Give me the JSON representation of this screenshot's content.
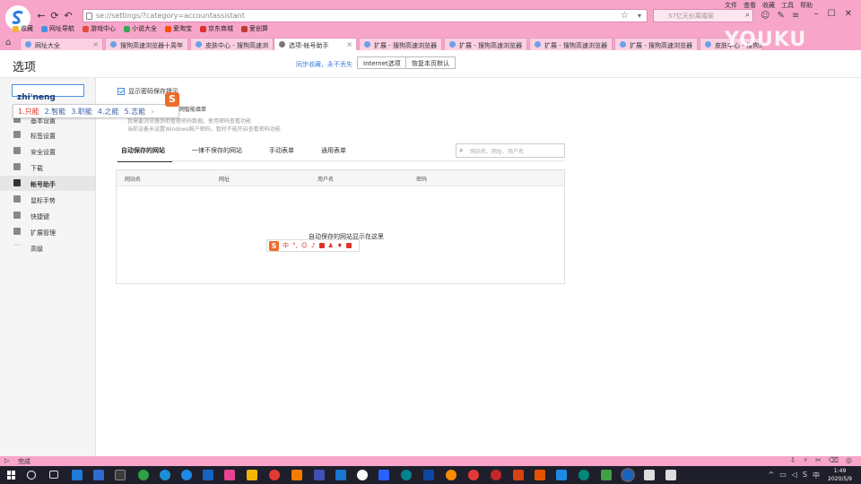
{
  "browser": {
    "url": "se://settings/?category=accountassistant",
    "search_placeholder": "57亿天价离婚案",
    "menu": [
      "文件",
      "查看",
      "收藏",
      "工具",
      "帮助"
    ],
    "bookmarks": [
      "收藏",
      "网址导航",
      "游戏中心",
      "小说大全",
      "爱淘宝",
      "京东商城",
      "爱创算"
    ],
    "tabs": [
      {
        "label": "网址大全",
        "active": false
      },
      {
        "label": "搜狗高速浏览器十周年",
        "active": false
      },
      {
        "label": "皮肤中心 - 搜狗高速浏",
        "active": false
      },
      {
        "label": "选项-帐号助手",
        "active": true
      },
      {
        "label": "扩展 - 搜狗高速浏览器",
        "active": false
      },
      {
        "label": "扩展 - 搜狗高速浏览器",
        "active": false
      },
      {
        "label": "扩展 - 搜狗高速浏览器",
        "active": false
      },
      {
        "label": "扩展 - 搜狗高速浏览器",
        "active": false
      },
      {
        "label": "皮肤中心 - 搜狗高速",
        "active": false
      }
    ],
    "watermark": "YOUKU"
  },
  "page": {
    "title": "选项",
    "sync_text": "同步收藏，永不丢失",
    "internet_options": "Internet选项",
    "restore_default": "恢复本页默认"
  },
  "sidebar": {
    "search_value": "",
    "items": [
      {
        "label": "基本设置",
        "active": false
      },
      {
        "label": "标签设置",
        "active": false
      },
      {
        "label": "安全设置",
        "active": false
      },
      {
        "label": "下载",
        "active": false
      },
      {
        "label": "帐号助手",
        "active": true
      },
      {
        "label": "鼠标手势",
        "active": false
      },
      {
        "label": "快捷键",
        "active": false
      },
      {
        "label": "扩展管理",
        "active": false
      },
      {
        "label": "高级",
        "active": false
      }
    ]
  },
  "main": {
    "show_password_prompt": "显示密码保存提示",
    "smart_fill": "网智能填单",
    "hint1": "我需要浏览器协助管理密码数据。使用密码查看功能",
    "hint2": "当前设备未设置Windows帐户密码，暂时不能开启查看密码功能",
    "subtabs": [
      {
        "label": "自动保存的网站",
        "active": true
      },
      {
        "label": "一律不保存的网站",
        "active": false
      },
      {
        "label": "手动表单",
        "active": false
      },
      {
        "label": "通用表单",
        "active": false
      }
    ],
    "site_search_placeholder": "网站名、网址、用户名",
    "columns": [
      "网站名",
      "网址",
      "用户名",
      "密码"
    ],
    "empty_text": "自动保存的网站显示在这里"
  },
  "ime": {
    "pinyin": "zhi'neng",
    "candidates": [
      "1.只能",
      "2.智能",
      "3.职能",
      "4.之能",
      "5.志能"
    ],
    "toolbar_lang": "中"
  },
  "status": {
    "text": "完成"
  },
  "taskbar": {
    "time": "1:49",
    "date": "2020/5/9"
  },
  "colors": {
    "chrome_pink": "#f7a6c9",
    "accent_blue": "#4a90e2",
    "taskbar": "#1f1f2b"
  }
}
